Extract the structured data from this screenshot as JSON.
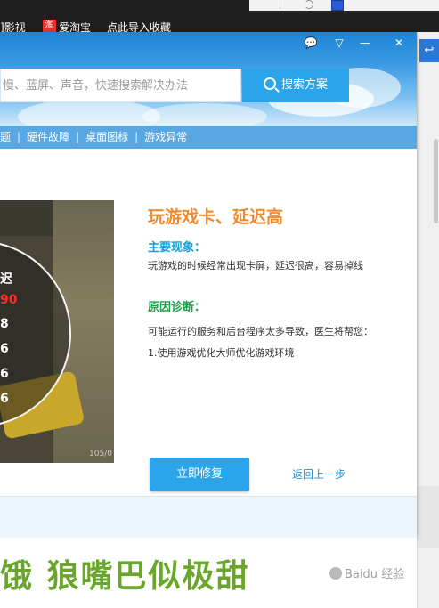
{
  "browser": {
    "bookmarks": [
      "]影视",
      "爱淘宝",
      "点此导入收藏"
    ],
    "tao_badge": "淘"
  },
  "dialog": {
    "window_buttons": {
      "chat": "💬",
      "menu": "▽",
      "minimize": "—",
      "close": "✕"
    },
    "search": {
      "placeholder": "慢、蓝屏、声音，快速搜索解决办法",
      "button_label": "搜索方案"
    },
    "nav": [
      "题",
      "硬件故障",
      "桌面图标",
      "游戏异常"
    ],
    "problem": {
      "title": "玩游戏卡、延迟高",
      "symptom_heading": "主要现象：",
      "symptom_text": "玩游戏的时候经常出现卡屏，延迟很高，容易掉线",
      "cause_heading": "原因诊断：",
      "cause_text": "可能运行的服务和后台程序太多导致，医生将帮您：",
      "step_1": "1.使用游戏优化大师优化游戏环境"
    },
    "game_image": {
      "overlay_lines": [
        "迟",
        "90",
        "8",
        "6",
        "6",
        "6"
      ],
      "ammo": "105/0"
    },
    "actions": {
      "repair": "立即修复",
      "back": "返回上一步"
    }
  },
  "background": {
    "headline": "饿 狼嘴巴似极甜",
    "watermark": "Baidu 经验"
  },
  "colors": {
    "accent": "#2aa4ea",
    "title_orange": "#f08a2f",
    "symptom_blue": "#1a9fd6",
    "cause_green": "#22a049",
    "headline_green": "#6aa62c"
  }
}
